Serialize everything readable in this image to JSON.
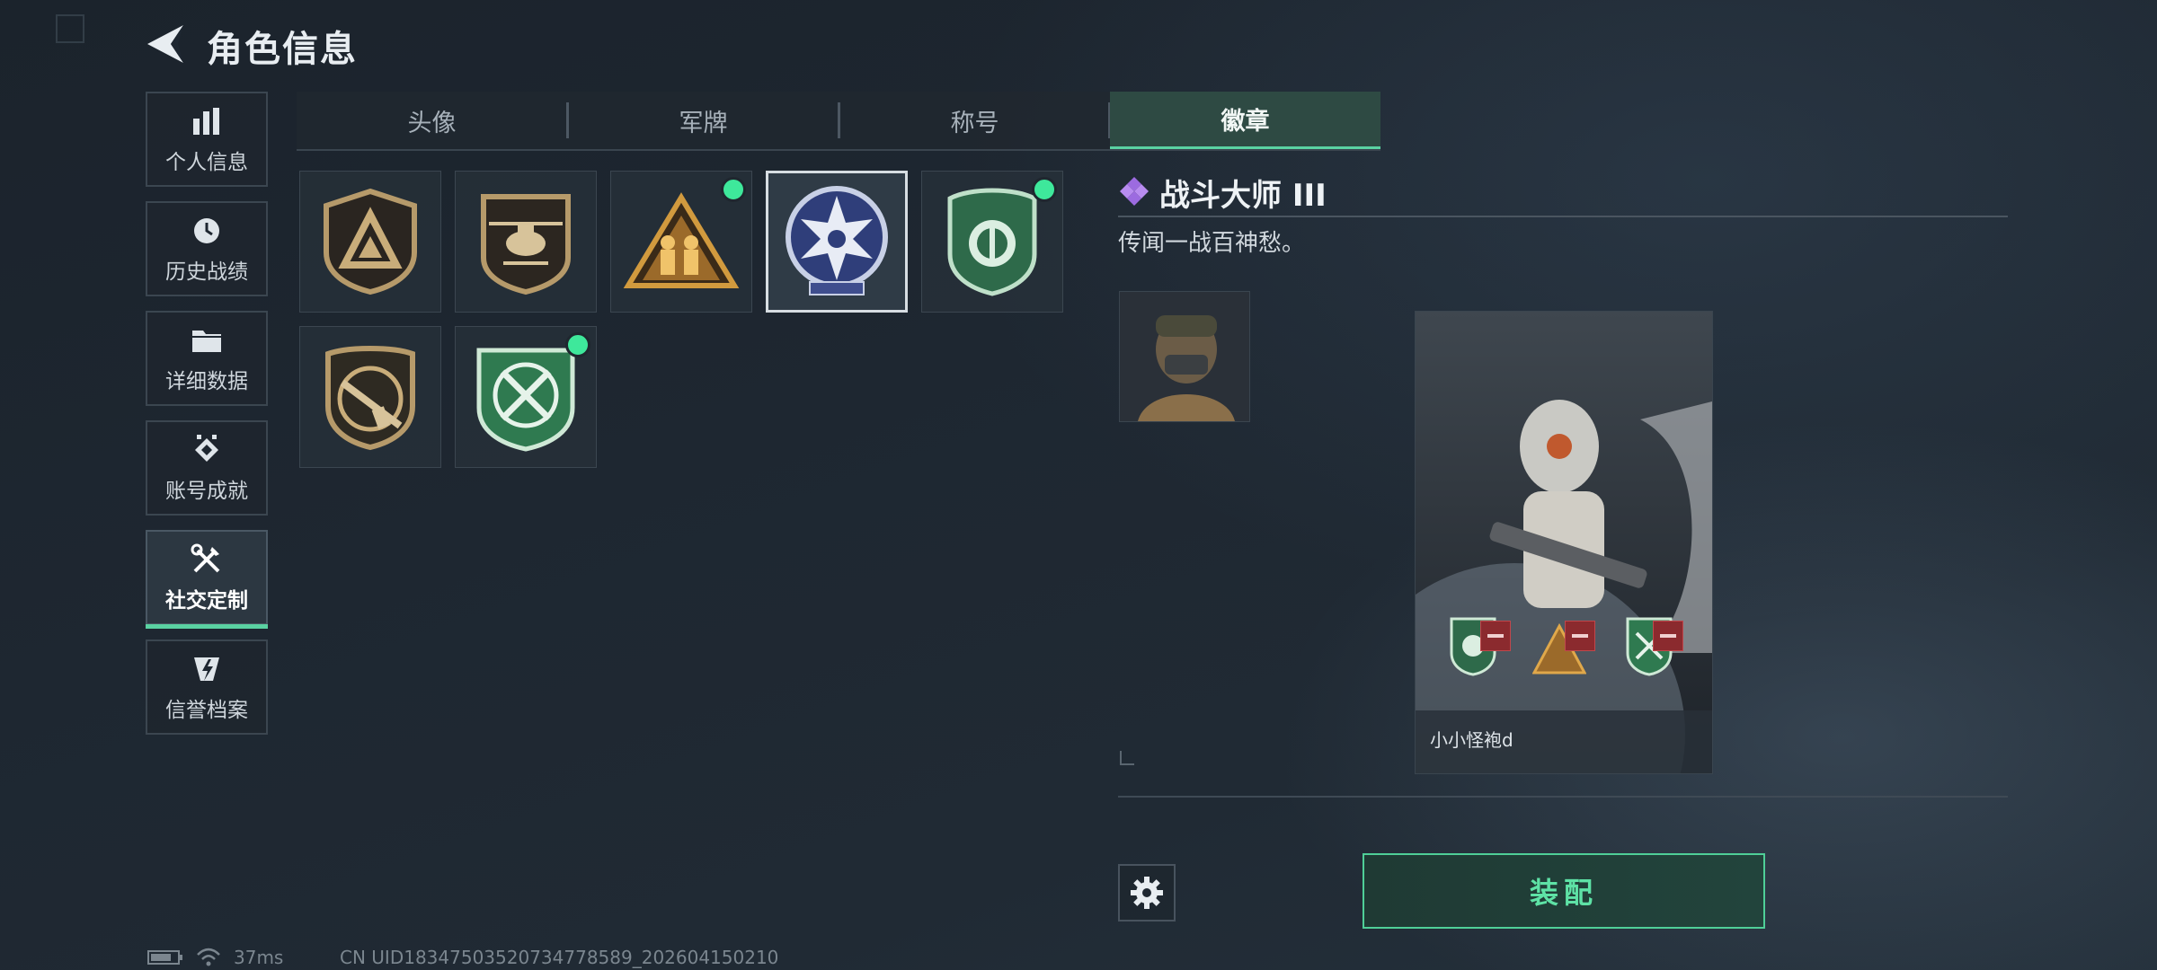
{
  "header": {
    "title": "角色信息"
  },
  "sidebar": {
    "items": [
      {
        "label": "个人信息",
        "icon": "bar-chart-icon"
      },
      {
        "label": "历史战绩",
        "icon": "clock-icon"
      },
      {
        "label": "详细数据",
        "icon": "folder-icon"
      },
      {
        "label": "账号成就",
        "icon": "achievement-icon"
      },
      {
        "label": "社交定制",
        "icon": "tools-icon",
        "active": true
      },
      {
        "label": "信誉档案",
        "icon": "shield-bolt-icon"
      }
    ]
  },
  "tabs": [
    {
      "label": "头像"
    },
    {
      "label": "军牌"
    },
    {
      "label": "称号"
    },
    {
      "label": "徽章",
      "active": true
    }
  ],
  "badges": [
    {
      "icon": "triangle-shield-badge-icon",
      "new": false,
      "selected": false
    },
    {
      "icon": "helicopter-badge-icon",
      "new": false,
      "selected": false
    },
    {
      "icon": "soldiers-triangle-badge-icon",
      "new": true,
      "selected": false
    },
    {
      "icon": "star-circle-badge-icon",
      "new": false,
      "selected": true
    },
    {
      "icon": "green-emblem-badge-icon",
      "new": true,
      "selected": false
    },
    {
      "icon": "rifle-badge-icon",
      "new": false,
      "selected": false
    },
    {
      "icon": "crossed-knives-badge-icon",
      "new": true,
      "selected": false
    }
  ],
  "detail": {
    "name": "战斗大师 III",
    "description": "传闻一战百神愁。",
    "icon": "purple-diamond-icon"
  },
  "card": {
    "player_name": "小小怪袍d"
  },
  "actions": {
    "equip_label": "装配",
    "settings_icon": "gear-icon"
  },
  "status_bar": {
    "ping": "37ms",
    "uid": "CN UID18347503520734778589_202604150210"
  },
  "colors": {
    "accent": "#5ad2a2",
    "new_dot": "#3ee89b",
    "remove": "#8b2a2e"
  }
}
